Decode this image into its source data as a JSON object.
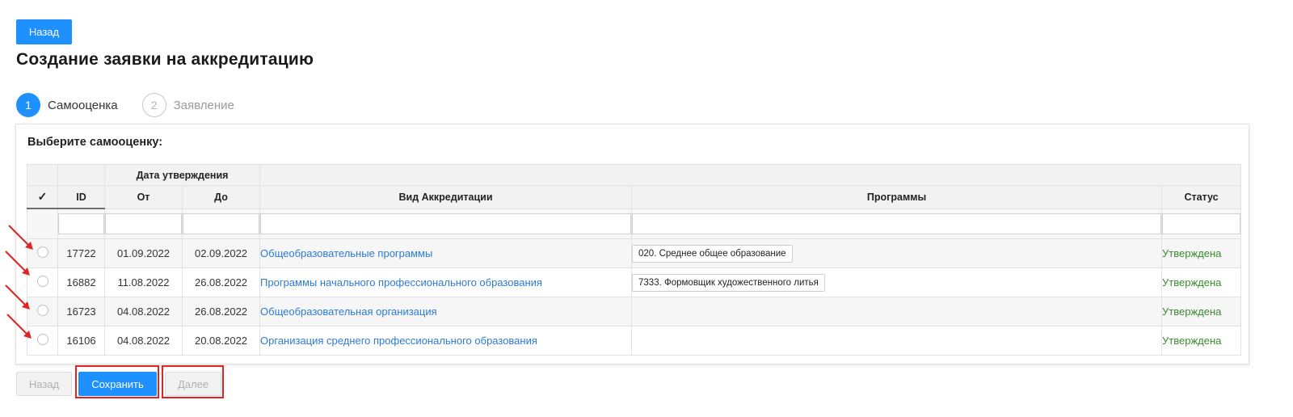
{
  "header": {
    "back_label": "Назад",
    "title": "Создание заявки на аккредитацию"
  },
  "steps": [
    {
      "number": "1",
      "label": "Самооценка",
      "state": "active"
    },
    {
      "number": "2",
      "label": "Заявление",
      "state": "inactive"
    }
  ],
  "card": {
    "heading": "Выберите самооценку:"
  },
  "table": {
    "group_header": "Дата утверждения",
    "columns": {
      "check": "✓",
      "id": "ID",
      "from": "От",
      "to": "До",
      "type": "Вид Аккредитации",
      "programs": "Программы",
      "status": "Статус"
    },
    "rows": [
      {
        "id": "17722",
        "from": "01.09.2022",
        "to": "02.09.2022",
        "type": "Общеобразовательные программы",
        "program": "020. Среднее общее образование",
        "status": "Утверждена"
      },
      {
        "id": "16882",
        "from": "11.08.2022",
        "to": "26.08.2022",
        "type": "Программы начального профессионального образования",
        "program": "7333. Формовщик художественного литья",
        "status": "Утверждена"
      },
      {
        "id": "16723",
        "from": "04.08.2022",
        "to": "26.08.2022",
        "type": "Общеобразовательная организация",
        "program": "",
        "status": "Утверждена"
      },
      {
        "id": "16106",
        "from": "04.08.2022",
        "to": "20.08.2022",
        "type": "Организация среднего профессионального образования",
        "program": "",
        "status": "Утверждена"
      }
    ]
  },
  "footer": {
    "back_label": "Назад",
    "save_label": "Сохранить",
    "next_label": "Далее"
  },
  "colors": {
    "primary": "#1e90ff",
    "link": "#2b7bd8",
    "status_approved": "#3a8a2e",
    "annotation": "#e02424"
  }
}
